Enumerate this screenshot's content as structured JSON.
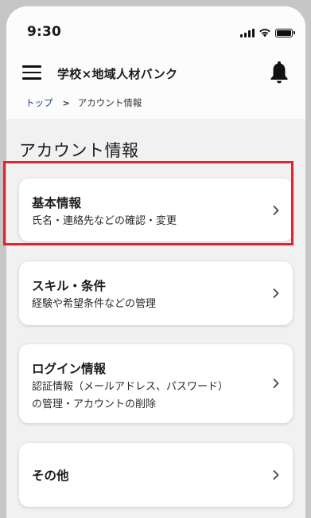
{
  "status_bar": {
    "time": "9:30"
  },
  "header": {
    "title": "学校×地域人材バンク"
  },
  "breadcrumb": {
    "home": "トップ",
    "separator": ">",
    "current": "アカウント情報"
  },
  "page": {
    "title": "アカウント情報"
  },
  "cards": [
    {
      "title": "基本情報",
      "desc": "氏名・連絡先などの確認・変更"
    },
    {
      "title": "スキル・条件",
      "desc": "経験や希望条件などの管理"
    },
    {
      "title": "ログイン情報",
      "desc_line1": "認証情報（メールアドレス、パスワード）",
      "desc_line2": "の管理・アカウントの削除"
    },
    {
      "title": "その他"
    }
  ],
  "colors": {
    "highlight": "#e1232e",
    "link": "#1d3f7a",
    "background": "#f1f1f1"
  },
  "icons": [
    "menu-icon",
    "bell-icon",
    "chevron-right-icon",
    "signal-icon",
    "wifi-icon",
    "battery-icon"
  ]
}
